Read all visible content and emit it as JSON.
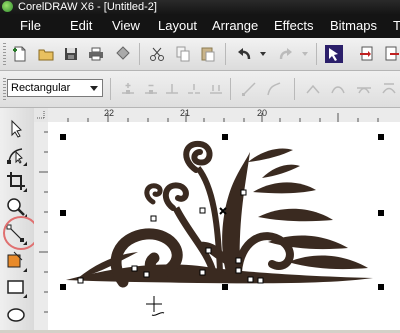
{
  "window": {
    "title": "CorelDRAW X6 - [Untitled-2]"
  },
  "menu": {
    "items": [
      {
        "label": "File"
      },
      {
        "label": "Edit"
      },
      {
        "label": "View"
      },
      {
        "label": "Layout"
      },
      {
        "label": "Arrange"
      },
      {
        "label": "Effects"
      },
      {
        "label": "Bitmaps"
      },
      {
        "label": "T"
      }
    ]
  },
  "property_bar": {
    "mode_value": "Rectangular"
  },
  "rulers": {
    "horizontal_labels": [
      "22",
      "21",
      "20"
    ]
  },
  "colors": {
    "artwork": "#3a2a20",
    "menubar": "#141414",
    "highlight_ring": "#e07070"
  }
}
